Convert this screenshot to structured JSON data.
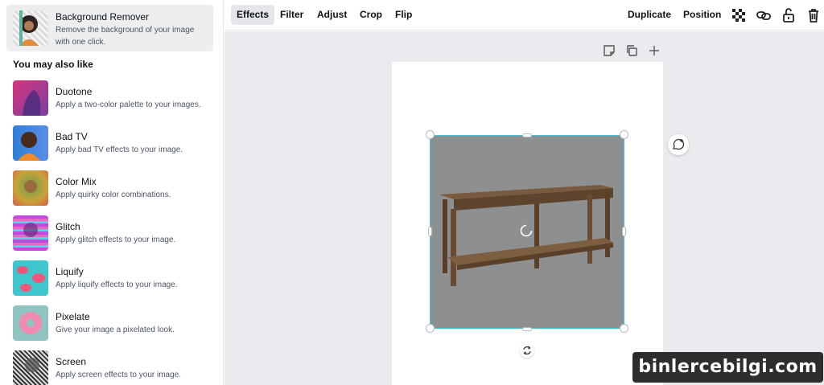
{
  "sidebar": {
    "featured": {
      "title": "Background Remover",
      "desc_line1": "Remove the background of your image",
      "desc_line2": "with one click."
    },
    "section_heading": "You may also like",
    "effects": [
      {
        "title": "Duotone",
        "desc": "Apply a two-color palette to your images."
      },
      {
        "title": "Bad TV",
        "desc": "Apply bad TV effects to your image."
      },
      {
        "title": "Color Mix",
        "desc": "Apply quirky color combinations."
      },
      {
        "title": "Glitch",
        "desc": "Apply glitch effects to your image."
      },
      {
        "title": "Liquify",
        "desc": "Apply liquify effects to your image."
      },
      {
        "title": "Pixelate",
        "desc": "Give your image a pixelated look."
      },
      {
        "title": "Screen",
        "desc": "Apply screen effects to your image."
      }
    ]
  },
  "toolbar": {
    "effects": "Effects",
    "filter": "Filter",
    "adjust": "Adjust",
    "crop": "Crop",
    "flip": "Flip",
    "duplicate": "Duplicate",
    "position": "Position"
  },
  "watermark": "binlercebilgi.com",
  "colors": {
    "selection": "#3ec6d8",
    "active_tab": "#e4e6ea"
  }
}
